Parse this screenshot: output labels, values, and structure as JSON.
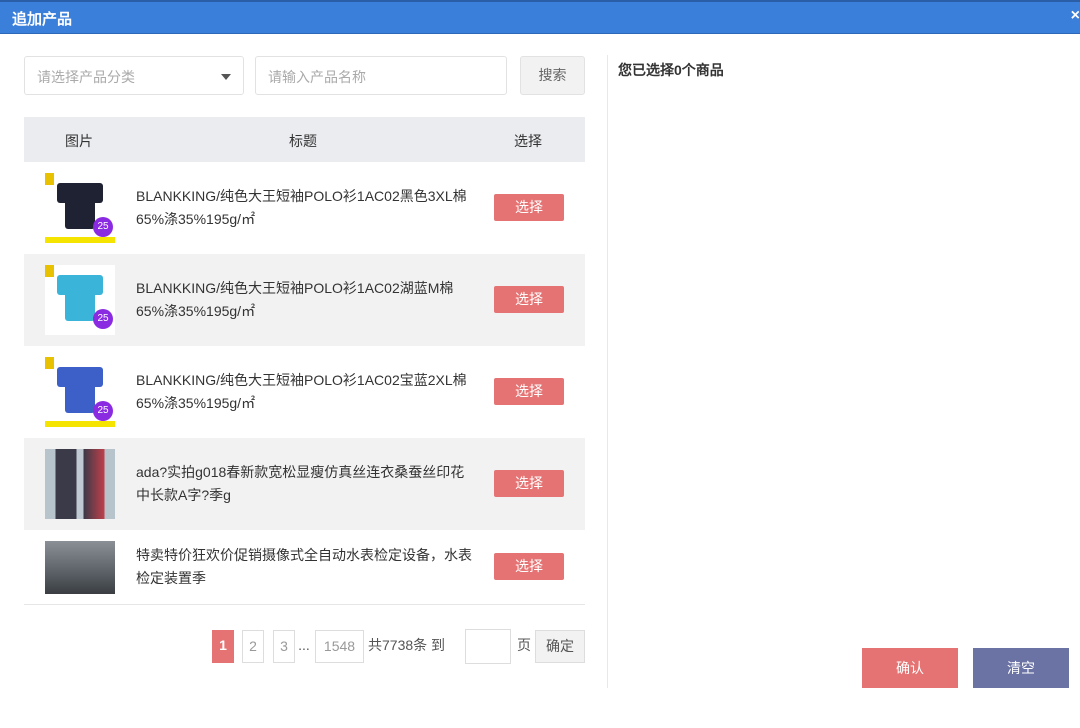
{
  "dialog": {
    "title": "追加产品",
    "close": "×"
  },
  "filters": {
    "category_placeholder": "请选择产品分类",
    "name_placeholder": "请输入产品名称",
    "search_label": "搜索"
  },
  "table": {
    "headers": [
      "图片",
      "标题",
      "选择"
    ],
    "rows": [
      {
        "title": "BLANKKING/纯色大王短袖POLO衫1AC02黑色3XL棉65%涤35%195g/㎡",
        "select": "选择",
        "shirt_color": "#1e2233"
      },
      {
        "title": "BLANKKING/纯色大王短袖POLO衫1AC02湖蓝M棉65%涤35%195g/㎡",
        "select": "选择",
        "shirt_color": "#3ab5d9"
      },
      {
        "title": "BLANKKING/纯色大王短袖POLO衫1AC02宝蓝2XL棉65%涤35%195g/㎡",
        "select": "选择",
        "shirt_color": "#3c60c8"
      },
      {
        "title": "ada?实拍g018春新款宽松显瘦仿真丝连衣桑蚕丝印花中长款A字?季g",
        "select": "选择"
      },
      {
        "title": "特卖特价狂欢价促销摄像式全自动水表检定设备，水表检定装置季",
        "select": "选择"
      }
    ],
    "badge": "25"
  },
  "pagination": {
    "pages": [
      "1",
      "2",
      "3"
    ],
    "ellipsis": "...",
    "last": "1548",
    "total": "共7738条 到",
    "page_suffix": "页",
    "goto_value": "",
    "confirm": "确定",
    "current": 1
  },
  "right": {
    "selected_text": "您已选择0个商品",
    "confirm": "确认",
    "clear": "清空"
  }
}
